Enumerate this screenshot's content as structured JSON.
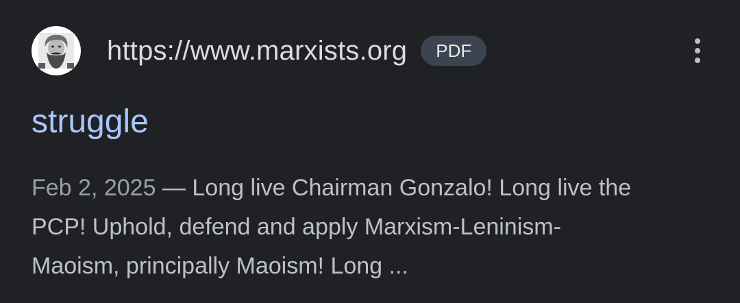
{
  "result": {
    "url": "https://www.marxists.org",
    "badge": "PDF",
    "title": "struggle",
    "date": "Feb 2, 2025",
    "separator": " — ",
    "snippet_lines": [
      "Long live Chairman Gonzalo! Long live the",
      "PCP! Uphold, defend and apply Marxism-Leninism-",
      "Maoism, principally Maoism! Long ..."
    ],
    "favicon": "marx-portrait-icon",
    "more_icon": "more-vert-icon"
  },
  "colors": {
    "background": "#202124",
    "title_link": "#a8c7fa",
    "badge_bg": "#3c4351",
    "text": "#bdc1c6",
    "date": "#9aa0a6"
  }
}
